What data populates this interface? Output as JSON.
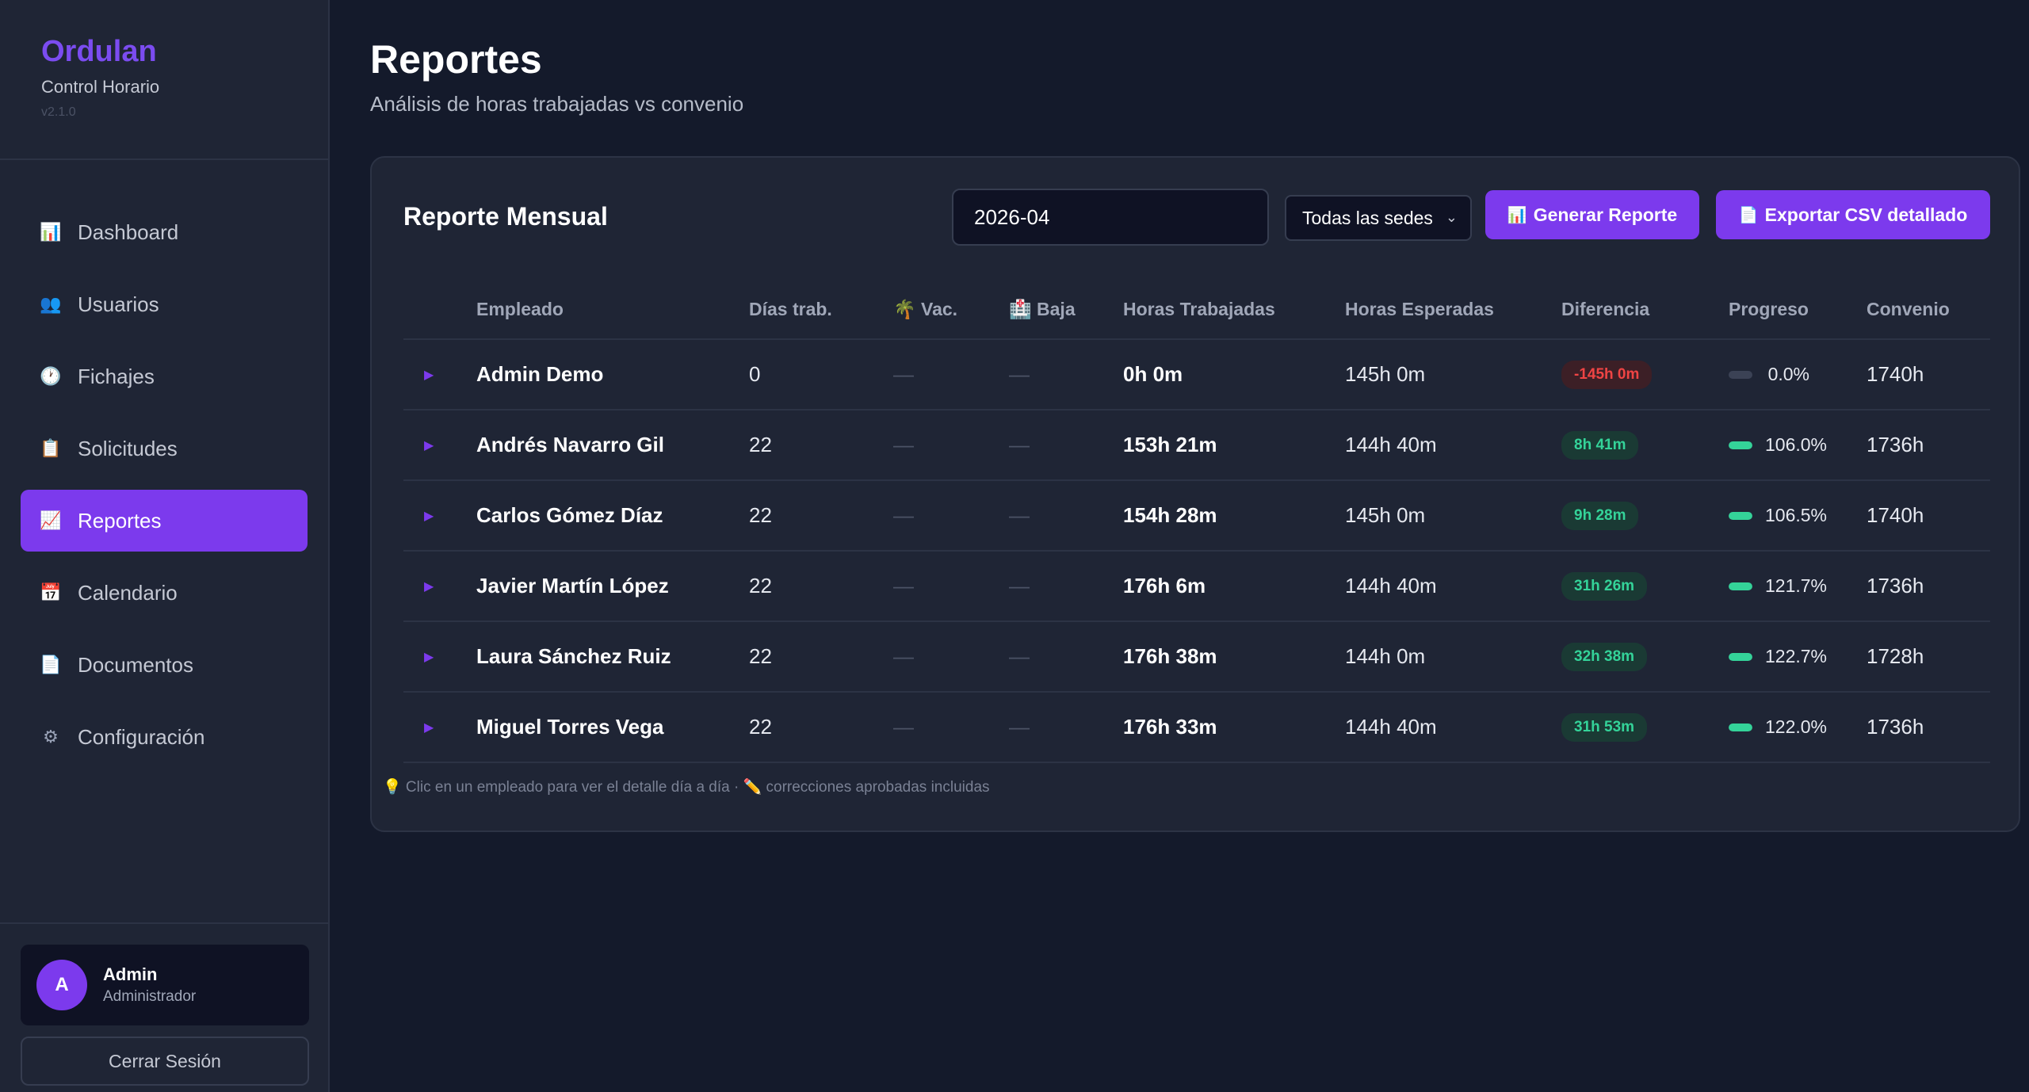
{
  "sidebar": {
    "brand": "Ordulan",
    "subtitle": "Control Horario",
    "version": "v2.1.0",
    "items": [
      {
        "label": "Dashboard",
        "icon": "📊",
        "icon_name": "chart-bar-icon"
      },
      {
        "label": "Usuarios",
        "icon": "👥",
        "icon_name": "users-icon"
      },
      {
        "label": "Fichajes",
        "icon": "🕐",
        "icon_name": "clock-icon"
      },
      {
        "label": "Solicitudes",
        "icon": "📋",
        "icon_name": "clipboard-icon"
      },
      {
        "label": "Reportes",
        "icon": "📈",
        "icon_name": "chart-up-icon",
        "active": true
      },
      {
        "label": "Calendario",
        "icon": "📅",
        "icon_name": "calendar-icon"
      },
      {
        "label": "Documentos",
        "icon": "📄",
        "icon_name": "document-icon"
      },
      {
        "label": "Configuración",
        "icon": "⚙",
        "icon_name": "gear-icon"
      }
    ],
    "user": {
      "initial": "A",
      "name": "Admin",
      "role": "Administrador"
    },
    "logout_label": "Cerrar Sesión"
  },
  "header": {
    "title": "Reportes",
    "subtitle": "Análisis de horas trabajadas vs convenio"
  },
  "report": {
    "title": "Reporte Mensual",
    "month_value": "2026-04",
    "sede_selected": "Todas las sedes",
    "generate_label": "Generar Reporte",
    "generate_icon": "📊",
    "export_label": "Exportar CSV detallado",
    "export_icon": "📄",
    "columns": {
      "employee": "Empleado",
      "days": "Días trab.",
      "vac": "Vac.",
      "vac_icon": "🌴",
      "baja": "Baja",
      "baja_icon": "🏥",
      "worked": "Horas Trabajadas",
      "expected": "Horas Esperadas",
      "diff": "Diferencia",
      "progress": "Progreso",
      "agreement": "Convenio"
    },
    "rows": [
      {
        "name": "Admin Demo",
        "days": "0",
        "vac": "—",
        "baja": "—",
        "worked": "0h 0m",
        "expected": "145h 0m",
        "diff": "-145h 0m",
        "diff_status": "negative",
        "progress": 0.0,
        "progress_label": "0.0%",
        "agreement": "1740h"
      },
      {
        "name": "Andrés Navarro Gil",
        "days": "22",
        "vac": "—",
        "baja": "—",
        "worked": "153h 21m",
        "expected": "144h 40m",
        "diff": "8h 41m",
        "diff_status": "positive",
        "progress": 106.0,
        "progress_label": "106.0%",
        "agreement": "1736h"
      },
      {
        "name": "Carlos Gómez Díaz",
        "days": "22",
        "vac": "—",
        "baja": "—",
        "worked": "154h 28m",
        "expected": "145h 0m",
        "diff": "9h 28m",
        "diff_status": "positive",
        "progress": 106.5,
        "progress_label": "106.5%",
        "agreement": "1740h"
      },
      {
        "name": "Javier Martín López",
        "days": "22",
        "vac": "—",
        "baja": "—",
        "worked": "176h 6m",
        "expected": "144h 40m",
        "diff": "31h 26m",
        "diff_status": "positive",
        "progress": 121.7,
        "progress_label": "121.7%",
        "agreement": "1736h"
      },
      {
        "name": "Laura Sánchez Ruiz",
        "days": "22",
        "vac": "—",
        "baja": "—",
        "worked": "176h 38m",
        "expected": "144h 0m",
        "diff": "32h 38m",
        "diff_status": "positive",
        "progress": 122.7,
        "progress_label": "122.7%",
        "agreement": "1728h"
      },
      {
        "name": "Miguel Torres Vega",
        "days": "22",
        "vac": "—",
        "baja": "—",
        "worked": "176h 33m",
        "expected": "144h 40m",
        "diff": "31h 53m",
        "diff_status": "positive",
        "progress": 122.0,
        "progress_label": "122.0%",
        "agreement": "1736h"
      }
    ],
    "footer_note": "💡 Clic en un empleado para ver el detalle día a día · ✏️ correcciones aprobadas incluidas"
  },
  "colors": {
    "accent": "#7c3aed",
    "positive": "#34d399",
    "negative": "#ef4444"
  }
}
